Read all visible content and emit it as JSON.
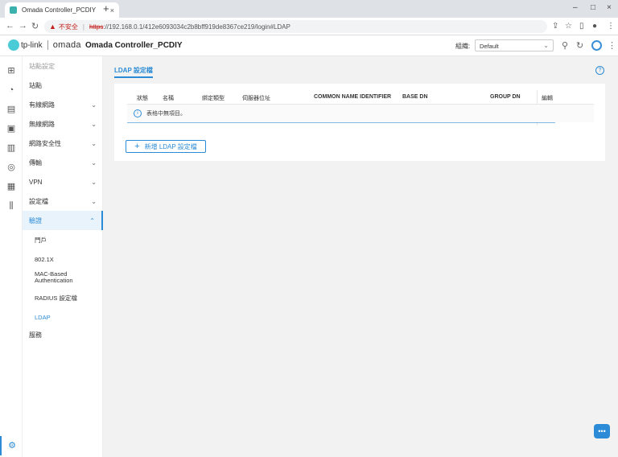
{
  "browser": {
    "tab_title": "Omada Controller_PCDIY",
    "tab_close": "×",
    "new_tab": "+",
    "win_minimize": "–",
    "win_maximize": "□",
    "win_close": "×",
    "security_warning": "不安全",
    "url_scheme": "https",
    "url_rest": "://192.168.0.1/412e6093034c2b8bff919de8367ce219/login#LDAP"
  },
  "header": {
    "logo_text": "tp-link",
    "omada_text": "omada",
    "controller_name": "Omada Controller_PCDIY",
    "org_label": "組織:",
    "org_value": "Default"
  },
  "sidebar": {
    "items": [
      {
        "label": "站點設定"
      },
      {
        "label": "站點"
      },
      {
        "label": "有線網路"
      },
      {
        "label": "無線網路"
      },
      {
        "label": "網路安全性"
      },
      {
        "label": "傳輸"
      },
      {
        "label": "VPN"
      },
      {
        "label": "設定檔"
      },
      {
        "label": "驗證"
      },
      {
        "label": "服務"
      }
    ],
    "sub_items": [
      {
        "label": "門戶"
      },
      {
        "label": "802.1X"
      },
      {
        "label": "MAC-Based Authentication"
      },
      {
        "label": "RADIUS 設定檔"
      },
      {
        "label": "LDAP"
      }
    ]
  },
  "main": {
    "tab_label": "LDAP 設定檔",
    "help": "?",
    "columns": {
      "status": "狀態",
      "name": "名稱",
      "bind_type": "綁定類型",
      "server_address": "伺服器位址",
      "common_name_identifier": "COMMON NAME IDENTIFIER",
      "base_dn": "BASE DN",
      "group_dn": "GROUP DN",
      "edit": "編輯"
    },
    "empty_message": "表格中無項目。",
    "info": "i",
    "add_button": "新增 LDAP 設定檔"
  }
}
